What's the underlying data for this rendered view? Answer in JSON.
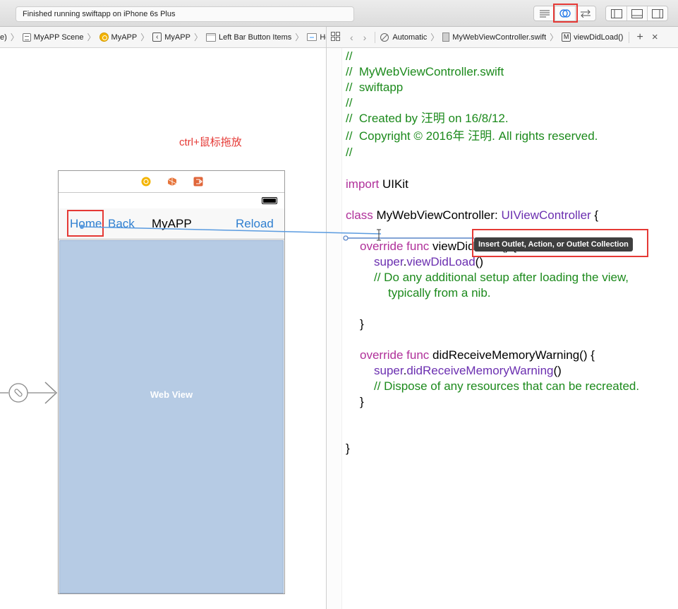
{
  "toolbar": {
    "status": "Finished running swiftapp on iPhone 6s Plus",
    "editor_buttons": [
      "standard-editor-icon",
      "assistant-editor-icon",
      "version-editor-icon"
    ],
    "view_buttons": [
      "navigator-toggle-icon",
      "debug-area-toggle-icon",
      "utilities-toggle-icon"
    ]
  },
  "left_jumpbar": {
    "crumbs": [
      "e)",
      "MyAPP Scene",
      "MyAPP",
      "MyAPP",
      "Left Bar Button Items",
      "Home"
    ]
  },
  "right_jumpbar": {
    "mode": "Automatic",
    "file": "MyWebViewController.swift",
    "method": "viewDidLoad()",
    "add_label": "+",
    "close_label": "×"
  },
  "canvas": {
    "annotation": "ctrl+鼠标拖放",
    "navbar": {
      "home": "Home",
      "back": "Back",
      "title": "MyAPP",
      "reload": "Reload"
    },
    "webview_label": "Web View"
  },
  "code": {
    "lines": [
      "//",
      "//  MyWebViewController.swift",
      "//  swiftapp",
      "//",
      "//  Created by 汪明 on 16/8/12.",
      "//  Copyright © 2016年 汪明. All rights reserved.",
      "//",
      "import UIKit",
      "class MyWebViewController: UIViewController {",
      "override func viewDidLoad() {",
      "super.viewDidLoad()",
      "// Do any additional setup after loading the view,",
      "typically from a nib.",
      "}",
      "override func didReceiveMemoryWarning() {",
      "super.didReceiveMemoryWarning()",
      "// Dispose of any resources that can be recreated.",
      "}",
      "}"
    ],
    "tooltip": "Insert Outlet, Action, or Outlet Collection"
  },
  "colors": {
    "highlight": "#e53935",
    "comment": "#1c8a1c",
    "keyword": "#b0309a",
    "type": "#6b2fb0",
    "nav_blue": "#2f7fd0",
    "webview_bg": "#b6cbe4"
  }
}
